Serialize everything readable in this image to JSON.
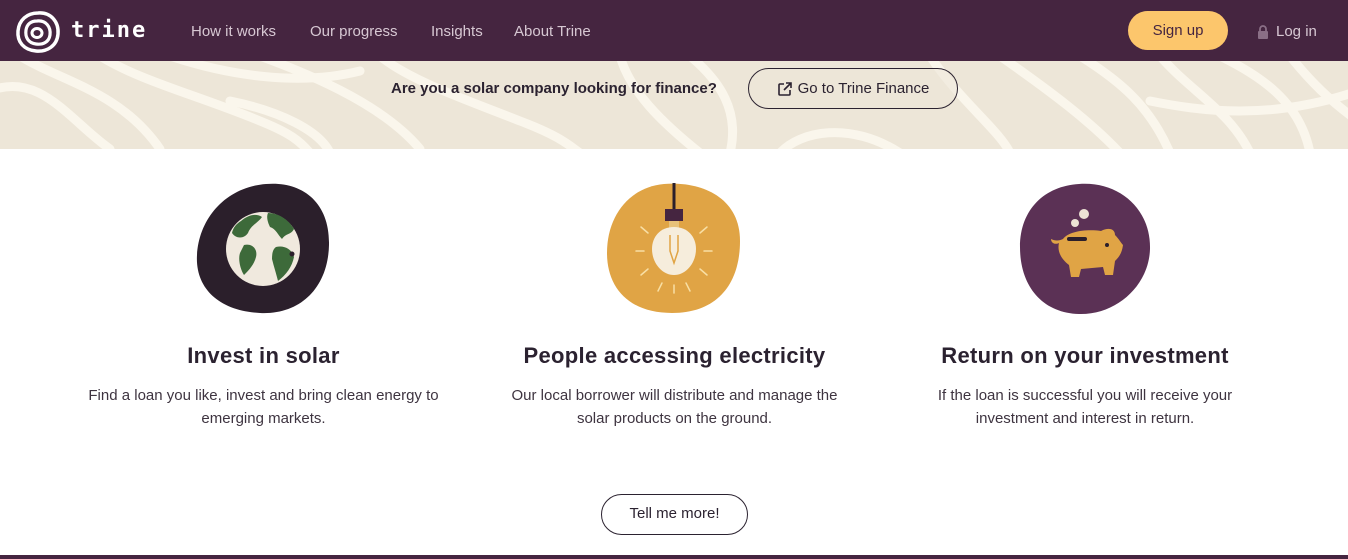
{
  "nav": {
    "logo_text": "trine",
    "links": [
      "How it works",
      "Our progress",
      "Insights",
      "About Trine"
    ],
    "signup_label": "Sign up",
    "login_label": "Log in"
  },
  "banner": {
    "question": "Are you a solar company looking for finance?",
    "button_label": "Go to Trine Finance"
  },
  "features": [
    {
      "title": "Invest in solar",
      "desc_line1": "Find a loan you like, invest and bring clean energy to",
      "desc_line2": "emerging markets.",
      "icon": "globe-icon"
    },
    {
      "title": "People accessing electricity",
      "desc_line1": "Our local borrower will distribute and manage the",
      "desc_line2": "solar products on the ground.",
      "icon": "lightbulb-icon"
    },
    {
      "title": "Return on your investment",
      "desc_line1": "If the loan is successful you will receive your",
      "desc_line2": "investment and interest in return.",
      "icon": "piggy-bank-icon"
    }
  ],
  "cta": {
    "label": "Tell me more!"
  },
  "colors": {
    "brand_purple": "#452540",
    "accent_yellow": "#fcc66c",
    "banner_bg": "#ede6d8",
    "globe_bg": "#2b1f2b",
    "bulb_bg": "#e0a445",
    "piggy_bg": "#5b3155"
  }
}
